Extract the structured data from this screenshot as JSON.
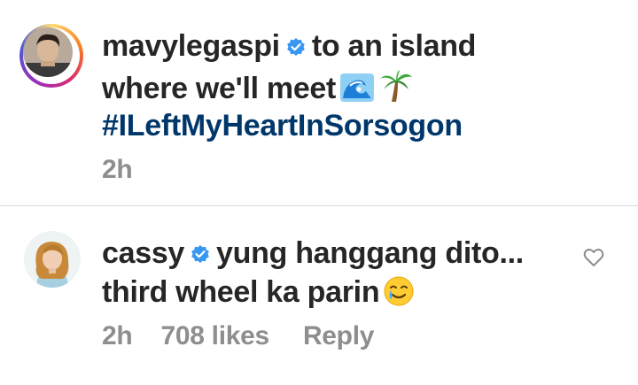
{
  "post_caption": {
    "username": "mavylegaspi",
    "text_line1": "to an island",
    "text_line2": "where we'll meet",
    "hashtag": "#ILeftMyHeartInSorsogon",
    "time": "2h",
    "emojis": [
      "wave-emoji",
      "palm-tree-emoji"
    ]
  },
  "comment": {
    "username": "cassy",
    "text_line1": "yung hanggang dito...",
    "text_line2": "third wheel ka parin",
    "time": "2h",
    "likes": "708 likes",
    "reply_label": "Reply",
    "emojis": [
      "smiling-tear-emoji"
    ]
  },
  "colors": {
    "text": "#262626",
    "meta": "#8e8e8e",
    "hashtag": "#00376b",
    "verified": "#3897f0",
    "divider": "#dbdbdb"
  }
}
